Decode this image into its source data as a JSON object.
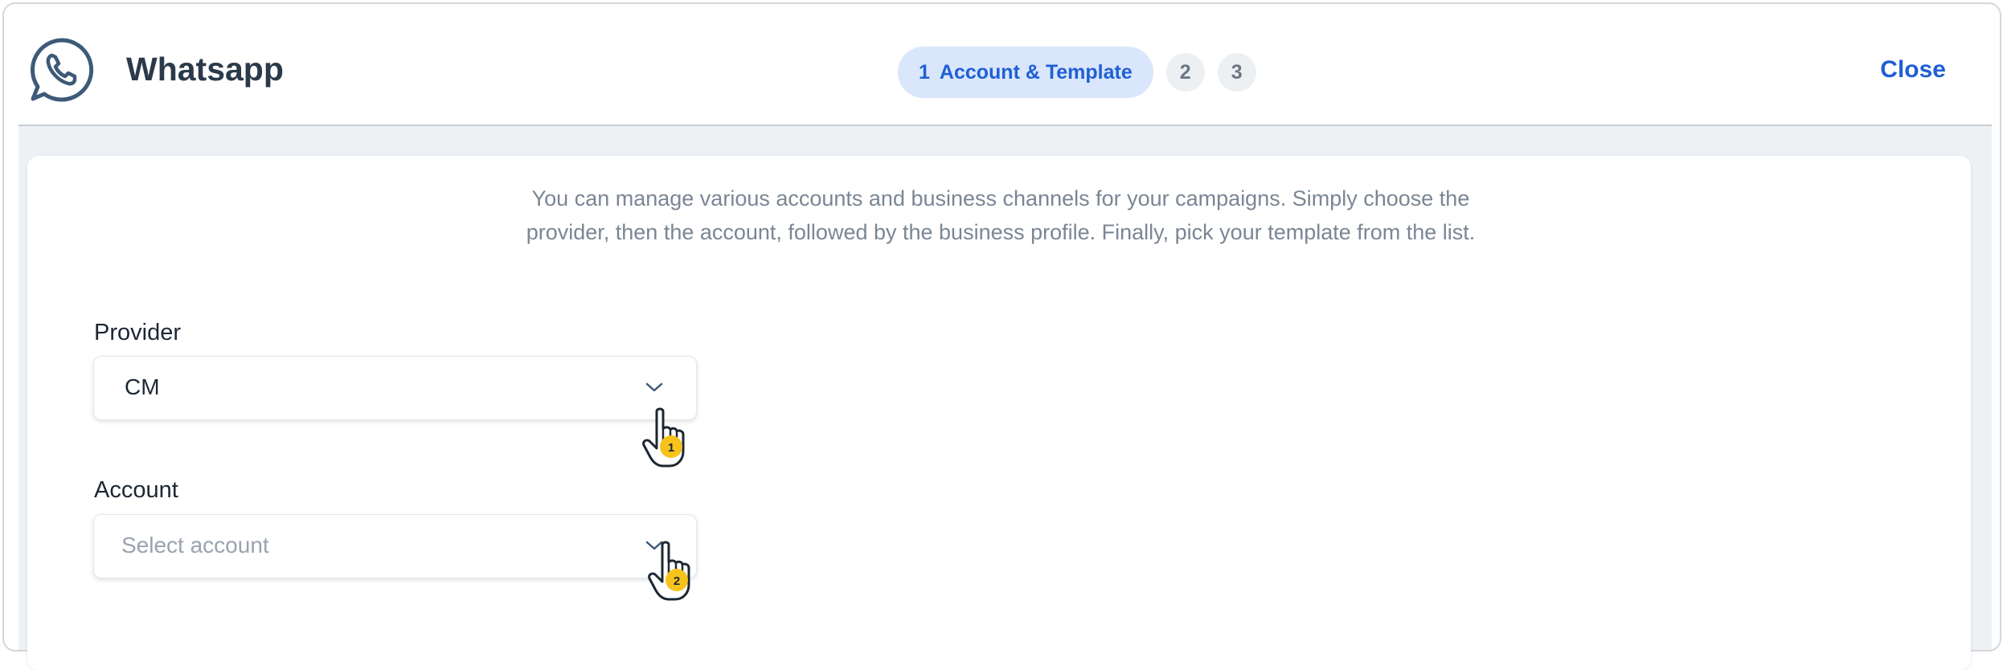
{
  "header": {
    "title": "Whatsapp",
    "logo_icon": "whatsapp-phone-icon",
    "close_label": "Close",
    "steps": [
      {
        "number": "1",
        "label": "Account & Template",
        "active": true
      },
      {
        "number": "2",
        "active": false
      },
      {
        "number": "3",
        "active": false
      }
    ]
  },
  "intro": {
    "text": "You can manage various accounts and business channels for your campaigns. Simply choose the provider, then the account, followed by the business profile. Finally, pick your template from the list."
  },
  "form": {
    "provider": {
      "label": "Provider",
      "value": "CM"
    },
    "account": {
      "label": "Account",
      "placeholder": "Select account"
    }
  },
  "annotations": [
    {
      "badge": "1"
    },
    {
      "badge": "2"
    }
  ],
  "colors": {
    "accent": "#1f5fd6",
    "step_active_bg": "#d9e6fb",
    "title": "#2b3a4a",
    "content_bg": "#edf1f4",
    "badge": "#f7c21b"
  }
}
